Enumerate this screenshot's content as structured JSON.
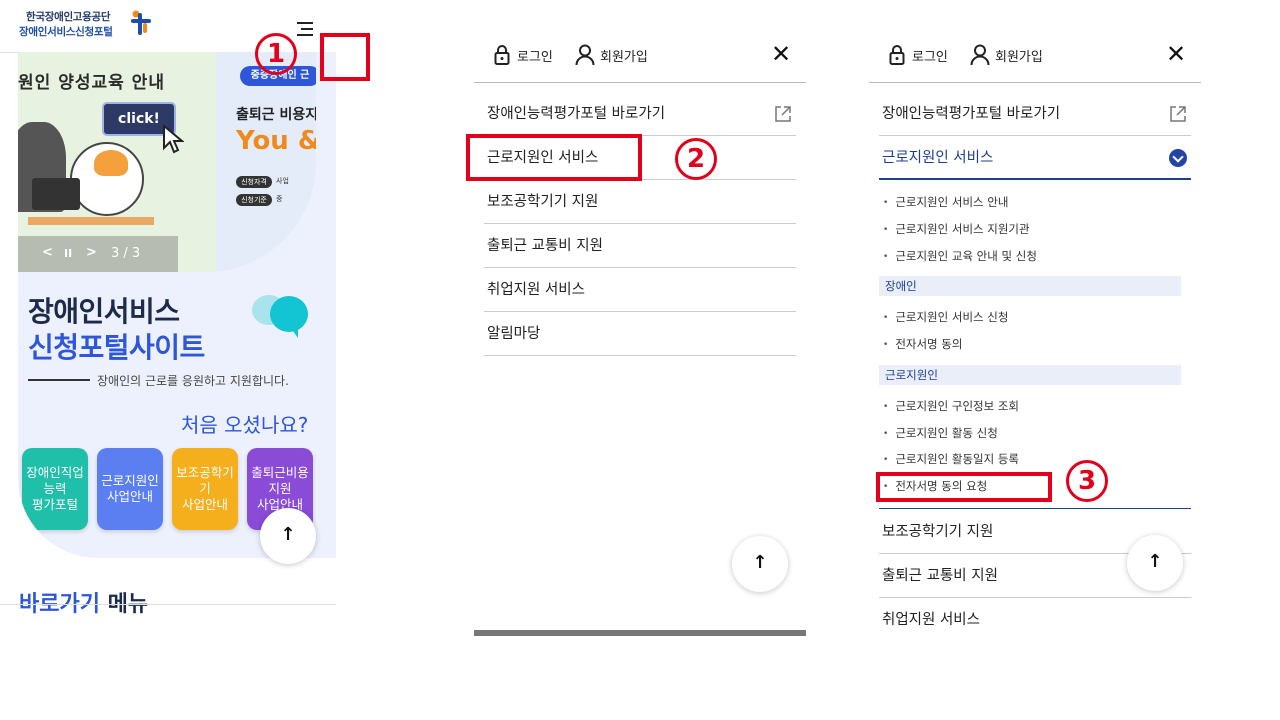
{
  "panel1": {
    "logo": {
      "line1": "한국장애인고용공단",
      "line2": "장애인서비스신청포털"
    },
    "banner": {
      "title": "원인 양성교육 안내",
      "click_label": "click!",
      "right_badge": "중증장애인 근",
      "right_line1": "출퇴근 비용지",
      "right_line2": "You &",
      "pill1": "신청자격",
      "pill1_after": "사업",
      "pill2": "신청기준",
      "pill2_after": "중",
      "prev": "<",
      "pause": "II",
      "next": ">",
      "counter": "3 / 3"
    },
    "site_title_line1": "장애인서비스",
    "site_title_line2": "신청포털사이트",
    "tagline": "장애인의 근로를 응원하고 지원합니다.",
    "first_visit": "처음 오셨나요?",
    "quick_buttons": [
      {
        "label": "장애인직업\n능력\n평가포털",
        "color": "#1fbfa9"
      },
      {
        "label": "근로지원인\n사업안내",
        "color": "#5b7ef0"
      },
      {
        "label": "보조공학기\n기\n사업안내",
        "color": "#f5ae1c"
      },
      {
        "label": "출퇴근비용\n지원\n사업안내",
        "color": "#8a4bd6"
      }
    ],
    "shortcut_title_a": "바로가기",
    "shortcut_title_b": " 메뉴",
    "top_button": "↑"
  },
  "panel2": {
    "login": "로그인",
    "join": "회원가입",
    "close": "✕",
    "menu": [
      "장애인능력평가포털 바로가기",
      "근로지원인 서비스",
      "보조공학기기 지원",
      "출퇴근 교통비 지원",
      "취업지원 서비스",
      "알림마당"
    ],
    "top_button": "↑"
  },
  "panel3": {
    "login": "로그인",
    "join": "회원가입",
    "close": "✕",
    "item_portal": "장애인능력평가포털 바로가기",
    "item_worker": "근로지원인 서비스",
    "sub_general": [
      "근로지원인 서비스 안내",
      "근로지원인 서비스 지원기관",
      "근로지원인 교육 안내 및 신청"
    ],
    "head_disabled": "장애인",
    "sub_disabled": [
      "근로지원인 서비스 신청",
      "전자서명 동의"
    ],
    "head_worker": "근로지원인",
    "sub_worker": [
      "근로지원인 구인정보 조회",
      "근로지원인 활동 신청",
      "근로지원인 활동일지 등록",
      "전자서명 동의 요청"
    ],
    "item_assist": "보조공학기기 지원",
    "item_commute": "출퇴근 교통비 지원",
    "item_job": "취업지원 서비스",
    "top_button": "↑"
  },
  "callouts": [
    "1",
    "2",
    "3"
  ],
  "colors": {
    "highlight": "#e3001b",
    "brand_blue": "#2d56d8",
    "active_nav": "#1e3f8f"
  }
}
